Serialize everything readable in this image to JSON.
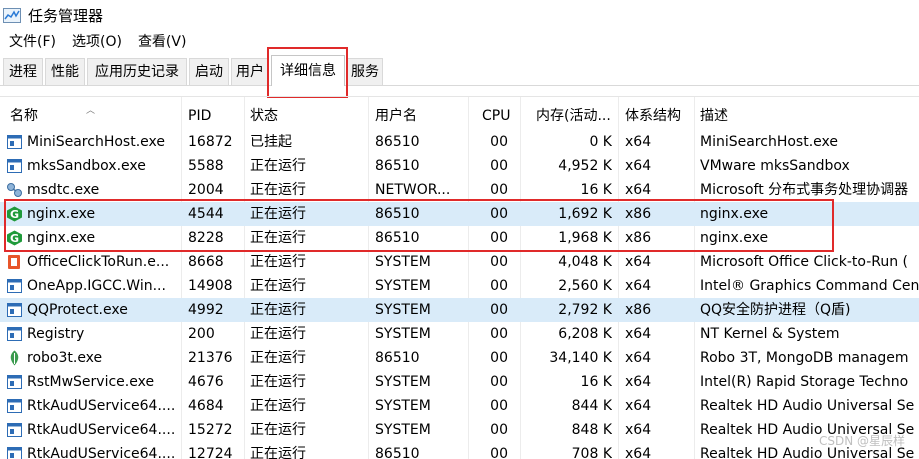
{
  "window": {
    "title": "任务管理器"
  },
  "menu": [
    "文件(F)",
    "选项(O)",
    "查看(V)"
  ],
  "tabs": [
    "进程",
    "性能",
    "应用历史记录",
    "启动",
    "用户",
    "详细信息",
    "服务"
  ],
  "active_tab": "详细信息",
  "columns": [
    "名称",
    "PID",
    "状态",
    "用户名",
    "CPU",
    "内存(活动...",
    "体系结构",
    "描述"
  ],
  "processes": [
    {
      "icon": "window-app-icon",
      "name": "MiniSearchHost.exe",
      "pid": "16872",
      "status": "已挂起",
      "user": "86510",
      "cpu": "00",
      "memory": "0 K",
      "arch": "x64",
      "desc": "MiniSearchHost.exe"
    },
    {
      "icon": "window-app-icon",
      "name": "mksSandbox.exe",
      "pid": "5588",
      "status": "正在运行",
      "user": "86510",
      "cpu": "00",
      "memory": "4,952 K",
      "arch": "x64",
      "desc": "VMware mksSandbox"
    },
    {
      "icon": "msdtc-icon",
      "name": "msdtc.exe",
      "pid": "2004",
      "status": "正在运行",
      "user": "NETWOR...",
      "cpu": "00",
      "memory": "16 K",
      "arch": "x64",
      "desc": "Microsoft 分布式事务处理协调器"
    },
    {
      "icon": "nginx-icon",
      "name": "nginx.exe",
      "pid": "4544",
      "status": "正在运行",
      "user": "86510",
      "cpu": "00",
      "memory": "1,692 K",
      "arch": "x86",
      "desc": "nginx.exe",
      "selected": true
    },
    {
      "icon": "nginx-icon",
      "name": "nginx.exe",
      "pid": "8228",
      "status": "正在运行",
      "user": "86510",
      "cpu": "00",
      "memory": "1,968 K",
      "arch": "x86",
      "desc": "nginx.exe"
    },
    {
      "icon": "office-icon",
      "name": "OfficeClickToRun.e...",
      "pid": "8668",
      "status": "正在运行",
      "user": "SYSTEM",
      "cpu": "00",
      "memory": "4,048 K",
      "arch": "x64",
      "desc": "Microsoft Office Click-to-Run ("
    },
    {
      "icon": "window-app-icon",
      "name": "OneApp.IGCC.Win...",
      "pid": "14908",
      "status": "正在运行",
      "user": "SYSTEM",
      "cpu": "00",
      "memory": "2,560 K",
      "arch": "x64",
      "desc": "Intel® Graphics Command Cen"
    },
    {
      "icon": "window-app-icon",
      "name": "QQProtect.exe",
      "pid": "4992",
      "status": "正在运行",
      "user": "SYSTEM",
      "cpu": "00",
      "memory": "2,792 K",
      "arch": "x86",
      "desc": "QQ安全防护进程（Q盾)",
      "selected": true
    },
    {
      "icon": "window-app-icon",
      "name": "Registry",
      "pid": "200",
      "status": "正在运行",
      "user": "SYSTEM",
      "cpu": "00",
      "memory": "6,208 K",
      "arch": "x64",
      "desc": "NT Kernel & System"
    },
    {
      "icon": "robo3t-icon",
      "name": "robo3t.exe",
      "pid": "21376",
      "status": "正在运行",
      "user": "86510",
      "cpu": "00",
      "memory": "34,140 K",
      "arch": "x64",
      "desc": "Robo 3T, MongoDB managem"
    },
    {
      "icon": "window-app-icon",
      "name": "RstMwService.exe",
      "pid": "4676",
      "status": "正在运行",
      "user": "SYSTEM",
      "cpu": "00",
      "memory": "16 K",
      "arch": "x64",
      "desc": "Intel(R) Rapid Storage Techno"
    },
    {
      "icon": "window-app-icon",
      "name": "RtkAudUService64....",
      "pid": "4684",
      "status": "正在运行",
      "user": "SYSTEM",
      "cpu": "00",
      "memory": "844 K",
      "arch": "x64",
      "desc": "Realtek HD Audio Universal Se"
    },
    {
      "icon": "window-app-icon",
      "name": "RtkAudUService64....",
      "pid": "15272",
      "status": "正在运行",
      "user": "SYSTEM",
      "cpu": "00",
      "memory": "848 K",
      "arch": "x64",
      "desc": "Realtek HD Audio Universal Se"
    },
    {
      "icon": "window-app-icon",
      "name": "RtkAudUService64....",
      "pid": "12724",
      "status": "正在运行",
      "user": "86510",
      "cpu": "00",
      "memory": "708 K",
      "arch": "x64",
      "desc": "Realtek HD Audio Universal Se"
    }
  ],
  "watermark": "CSDN @星辰样",
  "colors": {
    "selected_row": "#d9ebf9",
    "highlight_box": "#e02a2a",
    "nginx_green": "#1f9a3a"
  }
}
